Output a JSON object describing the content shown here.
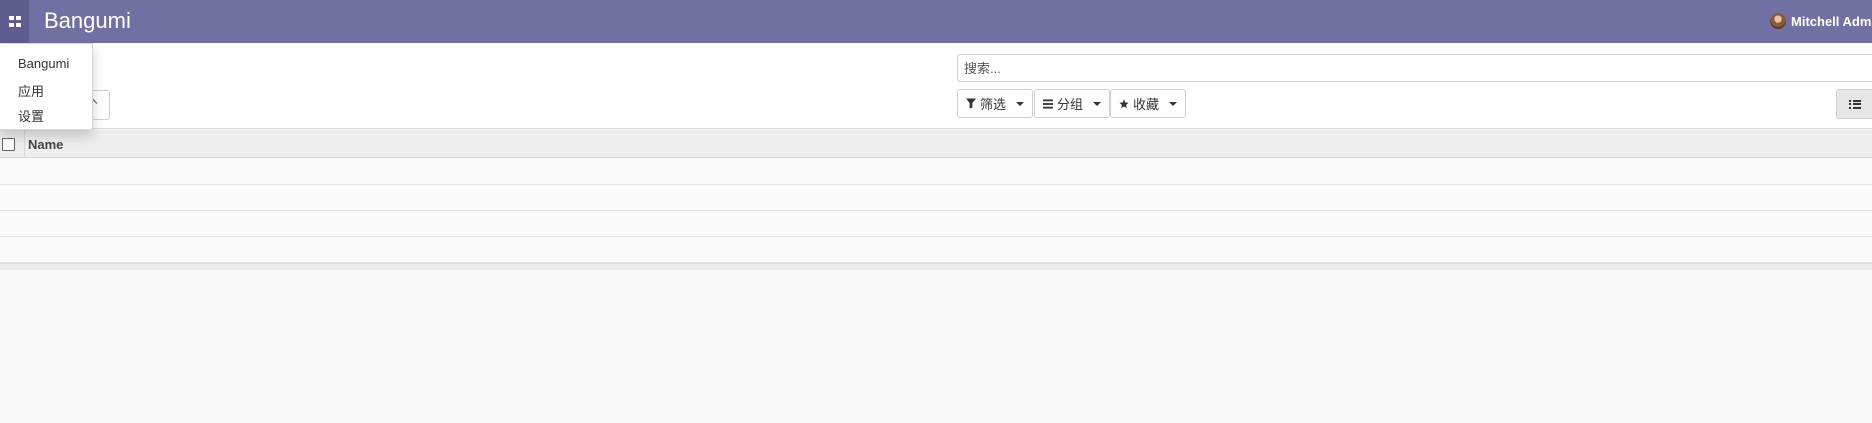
{
  "navbar": {
    "app_title": "Bangumi",
    "user_name": "Mitchell Adm"
  },
  "app_menu": {
    "items": [
      "Bangumi",
      "应用",
      "设置"
    ]
  },
  "search": {
    "placeholder": "搜索..."
  },
  "filters": {
    "filter_label": "筛选",
    "group_label": "分组",
    "favorites_label": "收藏"
  },
  "list": {
    "columns": [
      "Name"
    ],
    "row_count": 4
  },
  "colors": {
    "navbar": "#7170a2",
    "apps_button": "#5e5d90"
  },
  "icons": [
    "apps-grid-icon",
    "filter-icon",
    "group-bars-icon",
    "star-icon",
    "list-view-icon",
    "caret-down-icon",
    "caret-up-icon"
  ]
}
